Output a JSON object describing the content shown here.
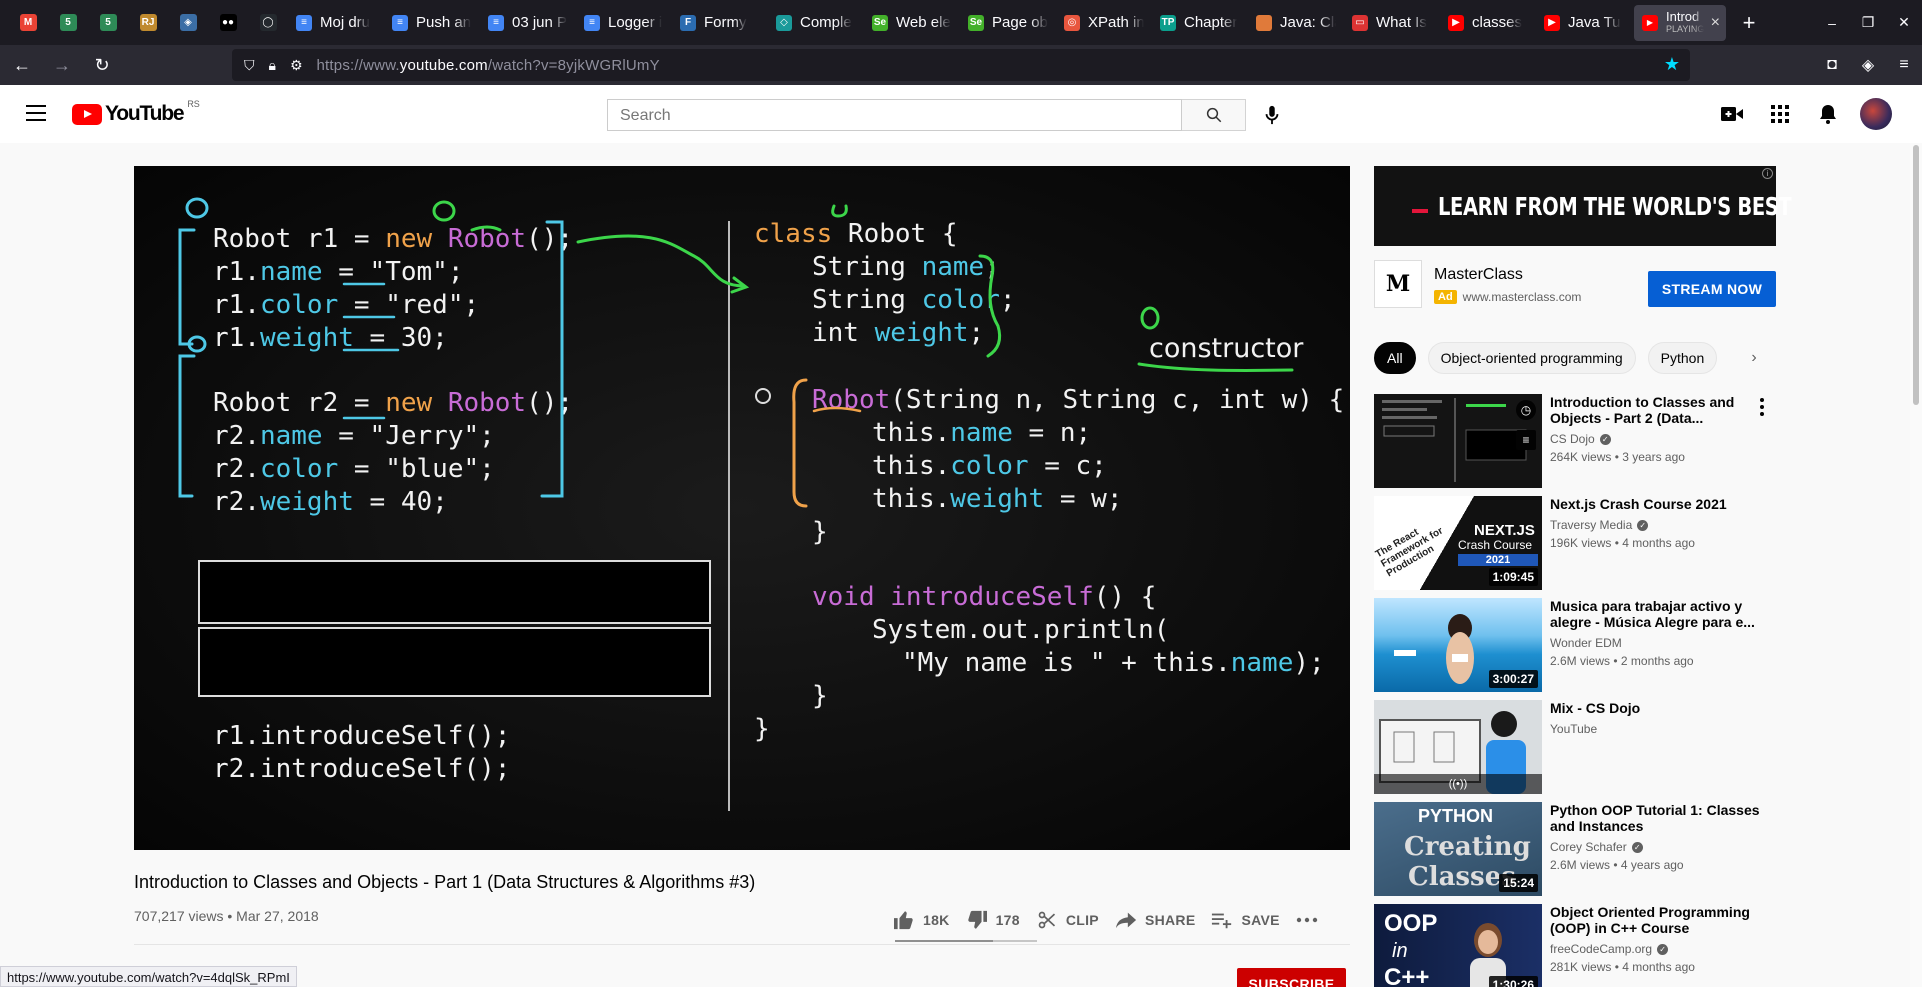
{
  "browser": {
    "pinned": [
      {
        "icon": "gmail-icon",
        "glyph": "M",
        "color": "#ea4335"
      },
      {
        "icon": "five-icon",
        "glyph": "5",
        "color": "#2e8b57"
      },
      {
        "icon": "five-icon",
        "glyph": "5",
        "color": "#2e8b57"
      },
      {
        "icon": "rj-icon",
        "glyph": "RJ",
        "color": "#c08a2e"
      },
      {
        "icon": "tool-icon",
        "glyph": "◈",
        "color": "#3b6ea5"
      },
      {
        "icon": "medium-icon",
        "glyph": "●●",
        "color": "#000000"
      },
      {
        "icon": "github-icon",
        "glyph": "◯",
        "color": "#24292e"
      }
    ],
    "tabs": [
      {
        "label": "Moj dru",
        "icon": "docs-icon",
        "color": "#4285f4",
        "glyph": "≡"
      },
      {
        "label": "Push an",
        "icon": "docs-icon",
        "color": "#4285f4",
        "glyph": "≡"
      },
      {
        "label": "03 jun P",
        "icon": "docs-icon",
        "color": "#4285f4",
        "glyph": "≡"
      },
      {
        "label": "Logger i",
        "icon": "docs-icon",
        "color": "#4285f4",
        "glyph": "≡"
      },
      {
        "label": "Formy",
        "icon": "formy-icon",
        "color": "#2b6cb0",
        "glyph": "F"
      },
      {
        "label": "Comple",
        "icon": "complete-icon",
        "color": "#1a9a9a",
        "glyph": "◇"
      },
      {
        "label": "Web ele",
        "icon": "selenium-icon",
        "color": "#43b02a",
        "glyph": "Se"
      },
      {
        "label": "Page ob",
        "icon": "selenium-icon",
        "color": "#43b02a",
        "glyph": "Se"
      },
      {
        "label": "XPath in",
        "icon": "xpath-icon",
        "color": "#e8563e",
        "glyph": "◎"
      },
      {
        "label": "Chapter",
        "icon": "tutorialspoint-icon",
        "color": "#0b9e8c",
        "glyph": "TP"
      },
      {
        "label": "Java: Cla",
        "icon": "java-icon",
        "color": "#e07a3a",
        "glyph": ""
      },
      {
        "label": "What Is",
        "icon": "box-icon",
        "color": "#d33",
        "glyph": "▭"
      },
      {
        "label": "classes",
        "icon": "youtube-icon",
        "color": "#ff0000",
        "glyph": "▶"
      },
      {
        "label": "Java Tu",
        "icon": "youtube-icon",
        "color": "#ff0000",
        "glyph": "▶"
      }
    ],
    "active_tab": {
      "label": "Introd",
      "sub": "PLAYING"
    },
    "url_prefix": "https://www.",
    "url_domain": "youtube.com",
    "url_path": "/watch?v=8yjkWGRlUmY"
  },
  "youtube": {
    "logo_text": "YouTube",
    "region": "RS",
    "search_placeholder": "Search"
  },
  "video": {
    "title": "Introduction to Classes and Objects - Part 1 (Data Structures & Algorithms #3)",
    "views_date": "707,217 views • Mar 27, 2018",
    "likes": "18K",
    "dislikes": "178",
    "like_ratio": 0.69,
    "clip_label": "CLIP",
    "share_label": "SHARE",
    "save_label": "SAVE",
    "subscribe_label": "SUBSCRIBE",
    "status_url": "https://www.youtube.com/watch?v=4dqlSk_RPmI",
    "frame": {
      "left": [
        [
          "Robot r1 = ",
          "new",
          " ",
          "Robot",
          "();"
        ],
        [
          "r1.",
          "name",
          " = \"Tom\";"
        ],
        [
          "r1.",
          "color",
          " = \"red\";"
        ],
        [
          "r1.",
          "weight",
          " = 30;"
        ],
        [
          "Robot r2 = ",
          "new",
          " ",
          "Robot",
          "();"
        ],
        [
          "r2.",
          "name",
          " = \"Jerry\";"
        ],
        [
          "r2.",
          "color",
          " = \"blue\";"
        ],
        [
          "r2.",
          "weight",
          " = 40;"
        ],
        [
          "r1.introduceSelf();"
        ],
        [
          "r2.introduceSelf();"
        ]
      ],
      "right": {
        "class_kw": "class",
        "class_name": " Robot {",
        "f1_type": "String ",
        "f1": "name",
        "f1_end": ";",
        "f2_type": "String ",
        "f2": "color",
        "f2_end": ";",
        "f3_type": "int ",
        "f3": "weight",
        "f3_end": ";",
        "ctor_name": "Robot",
        "ctor_args": "(String n, String c, int w) {",
        "this1": "this.",
        "this1f": "name",
        "this1e": " = n;",
        "this2": "this.",
        "this2f": "color",
        "this2e": " = c;",
        "this3": "this.",
        "this3f": "weight",
        "this3e": " = w;",
        "close1": "}",
        "void_kw": "void",
        "method": " introduceSelf",
        "method_end": "() {",
        "println": "System.out.println(",
        "str": "\"My name is \" + this.",
        "str_f": "name",
        "str_end": ");",
        "close2": "}",
        "close3": "}",
        "annotation": "constructor"
      }
    }
  },
  "ad": {
    "slogan": "LEARN FROM THE WORLD'S BEST",
    "advertiser": "MasterClass",
    "badge": "Ad",
    "domain": "www.masterclass.com",
    "cta": "STREAM NOW",
    "info": "i"
  },
  "chips": [
    "All",
    "Object-oriented programming",
    "Python"
  ],
  "recommendations": [
    {
      "title": "Introduction to Classes and Objects - Part 2 (Data...",
      "channel": "CS Dojo",
      "verified": true,
      "meta": "264K views • 3 years ago",
      "duration": ""
    },
    {
      "title": "Next.js Crash Course 2021",
      "channel": "Traversy Media",
      "verified": true,
      "meta": "196K views • 4 months ago",
      "duration": "1:09:45"
    },
    {
      "title": "Musica para trabajar activo y alegre - Música Alegre para e...",
      "channel": "Wonder EDM",
      "verified": false,
      "meta": "2.6M views • 2 months ago",
      "duration": "3:00:27"
    },
    {
      "title": "Mix - CS Dojo",
      "channel": "YouTube",
      "verified": false,
      "meta": "",
      "duration": ""
    },
    {
      "title": "Python OOP Tutorial 1: Classes and Instances",
      "channel": "Corey Schafer",
      "verified": true,
      "meta": "2.6M views • 4 years ago",
      "duration": "15:24"
    },
    {
      "title": "Object Oriented Programming (OOP) in C++ Course",
      "channel": "freeCodeCamp.org",
      "verified": true,
      "meta": "281K views • 4 months ago",
      "duration": "1:30:26"
    }
  ],
  "thumb_text": {
    "nextjs_title": "NEXT.JS",
    "nextjs_sub": "Crash Course",
    "nextjs_year": "2021",
    "nextjs_side": "The React Framework for Production",
    "python_top": "PYTHON",
    "python_mid": "Creating",
    "python_bot": "Classes",
    "oop_top": "OOP",
    "oop_mid": "in",
    "oop_bot": "C++",
    "mix_icon": "((•))"
  }
}
